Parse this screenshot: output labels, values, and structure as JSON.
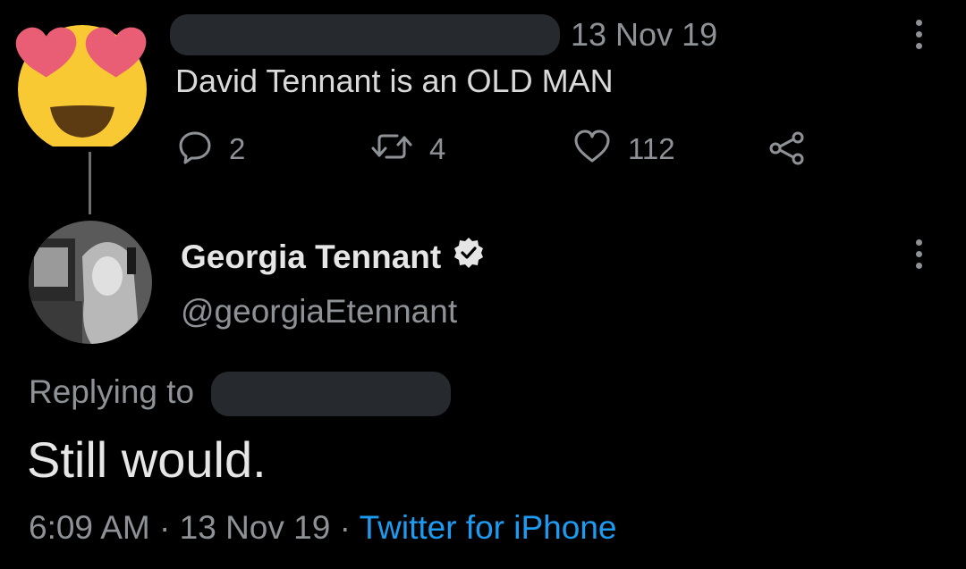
{
  "parent_tweet": {
    "date": "13 Nov 19",
    "text": "David Tennant is an OLD MAN",
    "actions": {
      "replies": "2",
      "retweets": "4",
      "likes": "112"
    }
  },
  "reply_tweet": {
    "display_name": "Georgia Tennant",
    "handle": "@georgiaEtennant",
    "replying_to_label": "Replying to",
    "text": "Still would.",
    "time": "6:09 AM",
    "separator": "·",
    "date": "13 Nov 19",
    "source": "Twitter for iPhone"
  },
  "colors": {
    "background": "#000000",
    "primary_text": "#d9d9d9",
    "secondary_text": "#8e9296",
    "link": "#1d9bf0",
    "redaction": "#262a2e"
  },
  "icons": {
    "parent_avatar": "heart-eyes-emoji-icon",
    "reply": "speech-bubble-icon",
    "retweet": "retweet-icon",
    "like": "heart-outline-icon",
    "share": "share-nodes-icon",
    "more": "kebab-menu-icon",
    "verified": "verified-badge-icon"
  }
}
